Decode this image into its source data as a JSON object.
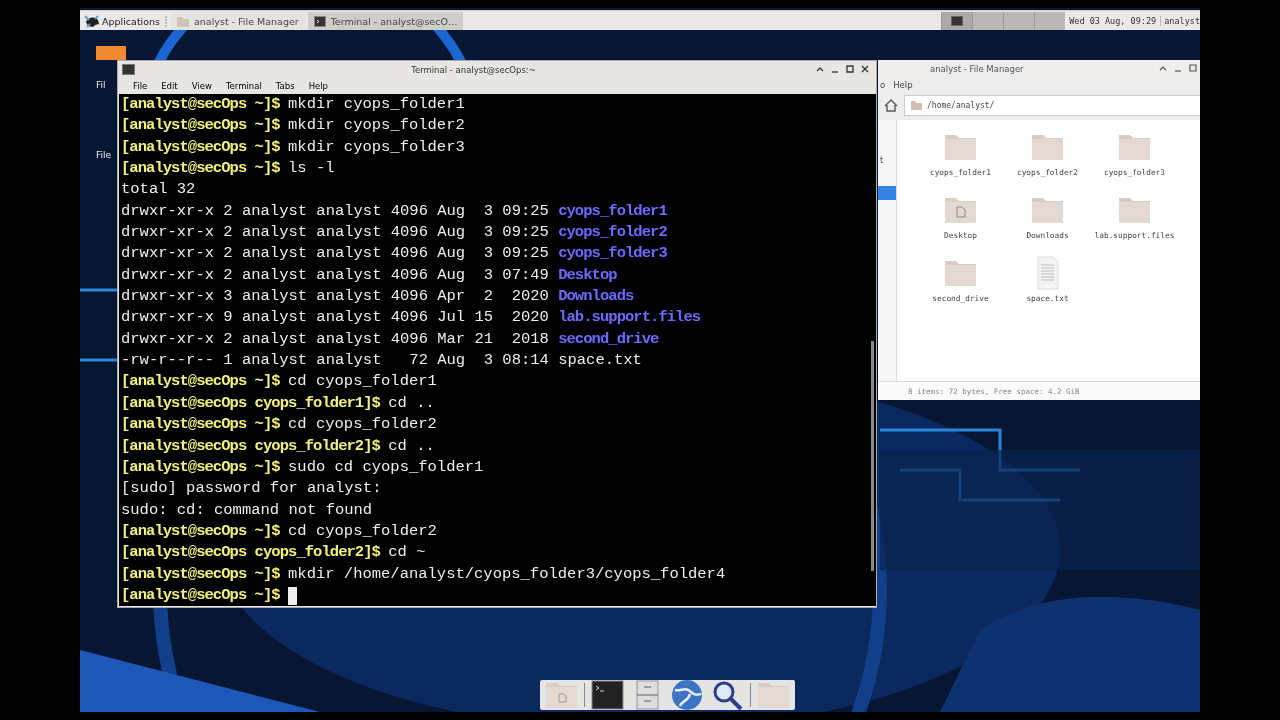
{
  "panel": {
    "menu": "Applications",
    "tasks": [
      {
        "label": "analyst - File Manager",
        "kind": "files",
        "selected": false
      },
      {
        "label": "Terminal - analyst@secO…",
        "kind": "terminal",
        "selected": true
      }
    ],
    "workspaces": [
      {
        "selected": true
      },
      {
        "selected": false
      },
      {
        "selected": false
      },
      {
        "selected": false
      }
    ],
    "clock": "Wed 03 Aug, 09:29",
    "user": "analyst"
  },
  "desktop_icons": [
    {
      "label": "Fil"
    },
    {
      "label": "File"
    }
  ],
  "terminal": {
    "title": "Terminal - analyst@secOps:~",
    "menu": [
      "File",
      "Edit",
      "View",
      "Terminal",
      "Tabs",
      "Help"
    ],
    "lines": [
      {
        "kind": "prompt",
        "prompt": "[analyst@secOps ~]$",
        "command": "mkdir cyops_folder1"
      },
      {
        "kind": "prompt",
        "prompt": "[analyst@secOps ~]$",
        "command": "mkdir cyops_folder2"
      },
      {
        "kind": "prompt",
        "prompt": "[analyst@secOps ~]$",
        "command": "mkdir cyops_folder3"
      },
      {
        "kind": "prompt",
        "prompt": "[analyst@secOps ~]$",
        "command": "ls -l"
      },
      {
        "kind": "output",
        "text": "total 32"
      },
      {
        "kind": "dir_listing",
        "text": "drwxr-xr-x 2 analyst analyst 4096 Aug  3 09:25 ",
        "name": "cyops_folder1"
      },
      {
        "kind": "dir_listing",
        "text": "drwxr-xr-x 2 analyst analyst 4096 Aug  3 09:25 ",
        "name": "cyops_folder2"
      },
      {
        "kind": "dir_listing",
        "text": "drwxr-xr-x 2 analyst analyst 4096 Aug  3 09:25 ",
        "name": "cyops_folder3"
      },
      {
        "kind": "dir_listing",
        "text": "drwxr-xr-x 2 analyst analyst 4096 Aug  3 07:49 ",
        "name": "Desktop"
      },
      {
        "kind": "dir_listing",
        "text": "drwxr-xr-x 3 analyst analyst 4096 Apr  2  2020 ",
        "name": "Downloads"
      },
      {
        "kind": "dir_listing",
        "text": "drwxr-xr-x 9 analyst analyst 4096 Jul 15  2020 ",
        "name": "lab.support.files"
      },
      {
        "kind": "dir_listing",
        "text": "drwxr-xr-x 2 analyst analyst 4096 Mar 21  2018 ",
        "name": "second_drive"
      },
      {
        "kind": "file_listing",
        "text": "-rw-r--r-- 1 analyst analyst   72 Aug  3 08:14 ",
        "name": "space.txt"
      },
      {
        "kind": "prompt",
        "prompt": "[analyst@secOps ~]$",
        "command": "cd cyops_folder1"
      },
      {
        "kind": "prompt",
        "prompt": "[analyst@secOps cyops_folder1]$",
        "command": "cd .."
      },
      {
        "kind": "prompt",
        "prompt": "[analyst@secOps ~]$",
        "command": "cd cyops_folder2"
      },
      {
        "kind": "prompt",
        "prompt": "[analyst@secOps cyops_folder2]$",
        "command": "cd .."
      },
      {
        "kind": "prompt",
        "prompt": "[analyst@secOps ~]$",
        "command": "sudo cd cyops_folder1"
      },
      {
        "kind": "output",
        "text": "[sudo] password for analyst:"
      },
      {
        "kind": "output",
        "text": "sudo: cd: command not found"
      },
      {
        "kind": "prompt",
        "prompt": "[analyst@secOps ~]$",
        "command": "cd cyops_folder2"
      },
      {
        "kind": "prompt",
        "prompt": "[analyst@secOps cyops_folder2]$",
        "command": "cd ~"
      },
      {
        "kind": "prompt",
        "prompt": "[analyst@secOps ~]$",
        "command": "mkdir /home/analyst/cyops_folder3/cyops_folder4"
      },
      {
        "kind": "prompt",
        "prompt": "[analyst@secOps ~]$",
        "cursor": true
      }
    ]
  },
  "file_manager": {
    "title": "analyst - File Manager",
    "menu": [
      "o",
      "Help"
    ],
    "path": "/home/analyst/",
    "sidebar": [
      {
        "label": "t",
        "selected": false
      },
      {
        "selected": true
      }
    ],
    "items": [
      {
        "name": "cyops_folder1",
        "kind": "folder"
      },
      {
        "name": "cyops_folder2",
        "kind": "folder"
      },
      {
        "name": "cyops_folder3",
        "kind": "folder"
      },
      {
        "name": "Desktop",
        "kind": "desktop"
      },
      {
        "name": "Downloads",
        "kind": "folder"
      },
      {
        "name": "lab.support.files",
        "kind": "folder"
      },
      {
        "name": "second_drive",
        "kind": "folder"
      },
      {
        "name": "space.txt",
        "kind": "text"
      }
    ],
    "status": "8 items: 72 bytes, Free space: 4.2 GiB"
  },
  "dock": [
    {
      "kind": "files"
    },
    {
      "kind": "terminal"
    },
    {
      "kind": "cabinet"
    },
    {
      "kind": "globe"
    },
    {
      "kind": "search"
    },
    {
      "kind": "folder"
    }
  ]
}
